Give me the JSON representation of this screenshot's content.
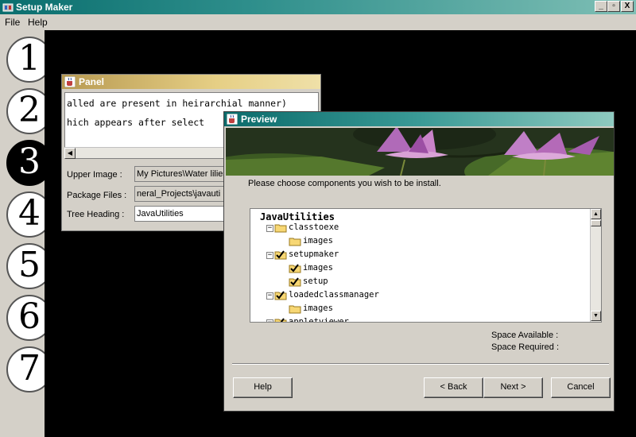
{
  "window": {
    "title": "Setup Maker",
    "controls": [
      "_",
      "▫",
      "X"
    ]
  },
  "menu": [
    "File",
    "Help"
  ],
  "steps": [
    {
      "number": "1",
      "active": false
    },
    {
      "number": "2",
      "active": false
    },
    {
      "number": "3",
      "active": true
    },
    {
      "number": "4",
      "active": false
    },
    {
      "number": "5",
      "active": false
    },
    {
      "number": "6",
      "active": false
    },
    {
      "number": "7",
      "active": false
    }
  ],
  "panel": {
    "title": "Panel",
    "text_lines": [
      "alled are present in heirarchial manner)",
      "hich appears after select"
    ],
    "fields": [
      {
        "label": "Upper Image :",
        "value": "My Pictures\\Water lilies"
      },
      {
        "label": "Package Files :",
        "value": "neral_Projects\\javauti"
      },
      {
        "label": "Tree Heading :",
        "value": "JavaUtilities"
      }
    ]
  },
  "preview": {
    "title": "Preview",
    "instruction": "Please choose components you wish to be install.",
    "tree": {
      "root": "JavaUtilities",
      "nodes": [
        {
          "label": "classtoexe",
          "checked": false,
          "expandable": true,
          "level": 1
        },
        {
          "label": "images",
          "checked": false,
          "expandable": false,
          "level": 2
        },
        {
          "label": "setupmaker",
          "checked": true,
          "expandable": true,
          "level": 1
        },
        {
          "label": "images",
          "checked": true,
          "expandable": false,
          "level": 2
        },
        {
          "label": "setup",
          "checked": true,
          "expandable": false,
          "level": 2
        },
        {
          "label": "loadedclassmanager",
          "checked": true,
          "expandable": true,
          "level": 1
        },
        {
          "label": "images",
          "checked": false,
          "expandable": false,
          "level": 2
        },
        {
          "label": "appletviewer",
          "checked": true,
          "expandable": true,
          "level": 1
        }
      ]
    },
    "space_available_label": "Space Available :",
    "space_required_label": "Space Required :",
    "buttons": {
      "help": "Help",
      "back": "< Back",
      "next": "Next >",
      "cancel": "Cancel"
    }
  }
}
